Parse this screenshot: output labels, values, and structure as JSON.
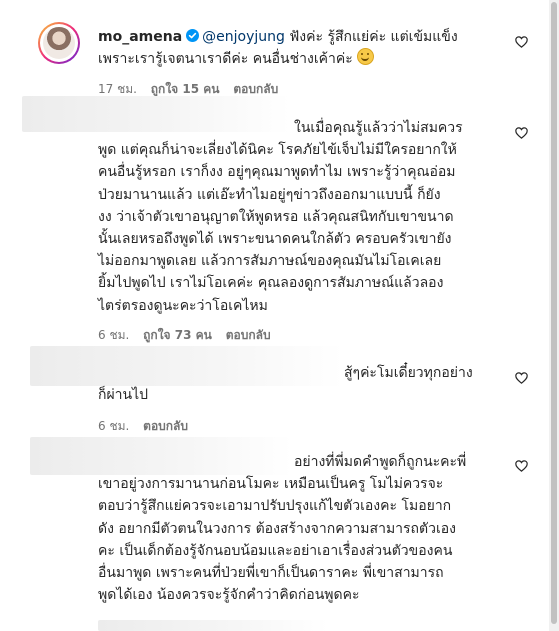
{
  "comments": [
    {
      "username": "mo_amena",
      "mention": "@enjoyjung",
      "first_line_text": " ฟังค่ะ รู้สึกแย่ค่ะ แต่เข้มแข็ง",
      "second_line_text": "เพราะเรารู้เจตนาเราดีค่ะ คนอื่นช่างเค้าค่ะ ",
      "time": "17 ชม.",
      "likes": "ถูกใจ 15 คน",
      "reply_label": "ตอบกลับ"
    },
    {
      "lines": [
        "ในเมื่อคุณรู้แล้วว่าไม่สมควร",
        "พูด แต่คุณก็น่าจะเลี่ยงได้นิคะ โรคภัยไข้เจ็บไม่มีใครอยากให้",
        "คนอื่นรู้หรอก เราก็งง อยู่ๆคุณมาพูดทำไม เพราะรู้ว่าคุณอ่อม",
        "ป่วยมานานแล้ว แต่เอ๊ะทำไมอยู่ๆข่าวถึงออกมาแบบนี้ ก็ยัง",
        "งง ว่าเจ้าตัวเขาอนุญาตให้พูดหรอ แล้วคุณสนิทกับเขาขนาด",
        "นั้นเลยหรอถึงพูดได้ เพราะขนาดคนใกล้ตัว ครอบครัวเขายัง",
        "ไม่ออกมาพูดเลย แล้วการสัมภาษณ์ของคุณมันไม่โอเคเลย",
        "ยิ้มไปพูดไป เราไม่โอเคค่ะ คุณลองดูการสัมภาษณ์แล้วลอง",
        "ไตร่ตรองดูนะคะว่าโอเคไหม"
      ],
      "time": "6 ชม.",
      "likes": "ถูกใจ 73 คน",
      "reply_label": "ตอบกลับ"
    },
    {
      "lines": [
        "สู้ๆค่ะโมเดี๋ยวทุกอย่าง",
        "ก็ผ่านไป"
      ],
      "time": "6 ชม.",
      "reply_label": "ตอบกลับ"
    },
    {
      "lines": [
        "อย่างที่พี่มดคำพูดก็ถูกนะคะพี่",
        "เขาอยู่วงการมานานก่อนโมคะ เหมือนเป็นครู โมไม่ควรจะ",
        "ตอบว่ารู้สึกแย่ควรจะเอามาปรับปรุงแก้ไขตัวเองคะ โมอยาก",
        "ดัง อยากมีตัวตนในวงการ ต้องสร้างจากความสามารถตัวเอง",
        "คะ เป็นเด็กต้องรู้จักนอบน้อมและอย่าเอาเรื่องส่วนตัวของคน",
        "อื่นมาพูด เพราะคนที่ป่วยพี่เขาก็เป็นดาราคะ พี่เขาสามารถ",
        "พูดได้เอง น้องควรจะรู้จักคำว่าคิดก่อนพูดคะ"
      ]
    }
  ]
}
